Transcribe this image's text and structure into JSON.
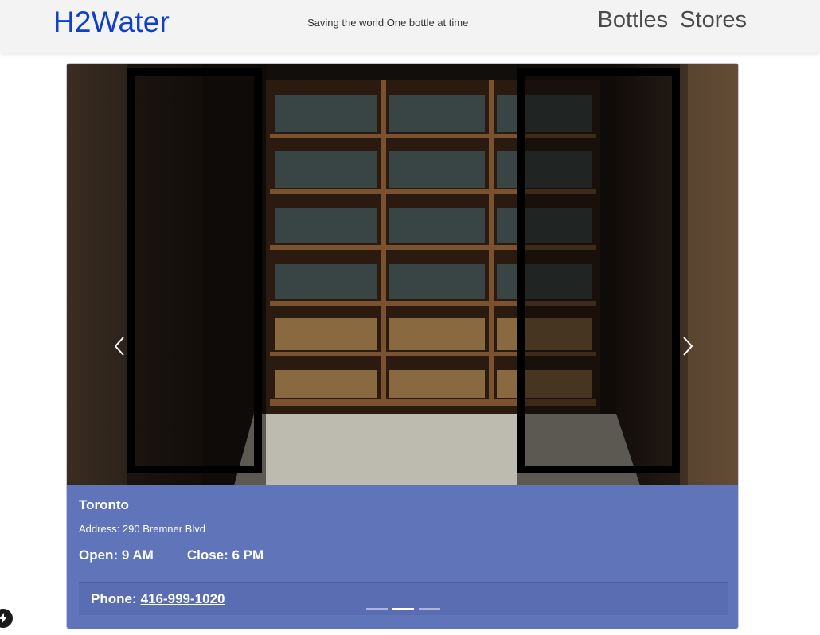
{
  "navbar": {
    "brand": "H2Water",
    "tagline": "Saving the world One bottle at time",
    "links": [
      "Bottles",
      "Stores"
    ]
  },
  "store": {
    "image_alt": "Bottle shop storefront with open glass doors and shelves of bottles",
    "name": "Toronto",
    "address": "Address: 290 Bremner Blvd",
    "open": "Open: 9 AM",
    "close": "Close: 6 PM",
    "phone_label": "Phone:",
    "phone_number": "416-999-1020"
  },
  "carousel": {
    "slide_count": 3,
    "active_index": 1,
    "prev_icon": "chevron-left-icon",
    "next_icon": "chevron-right-icon"
  },
  "colors": {
    "brand": "#0d3fc9",
    "caption_bg": "#6074b9",
    "navbar_bg": "#f3f3f3"
  }
}
